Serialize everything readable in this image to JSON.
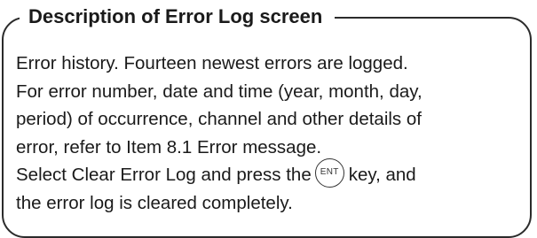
{
  "title": "Description of Error Log screen",
  "body": {
    "line1": "Error history. Fourteen newest errors are logged.",
    "line2": "For error number, date and time (year, month, day,",
    "line3": "period) of occurrence, channel and other details of",
    "line4": "error, refer to Item 8.1 Error message.",
    "line5_before_key": "Select Clear Error Log and press the",
    "line5_after_key": "key, and",
    "line6": "the error log is cleared completely."
  },
  "key_icon": {
    "label": "ENT",
    "icon": "enter-key-icon"
  }
}
